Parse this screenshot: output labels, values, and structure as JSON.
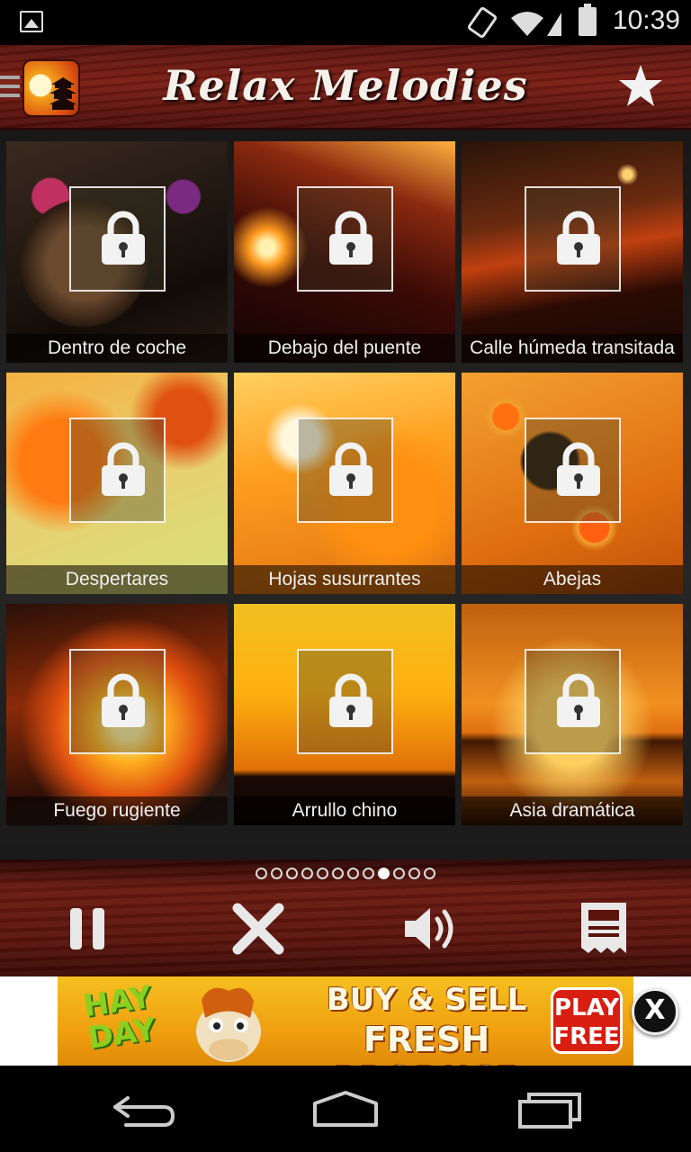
{
  "status_bar": {
    "time": "10:39",
    "icons": [
      "gallery-icon",
      "screen-rotation-icon",
      "wifi-icon",
      "signal-icon",
      "battery-icon"
    ]
  },
  "header": {
    "title": "Relax Melodies",
    "logo_icon": "pagoda-sunset-logo",
    "menu_icon": "hamburger-icon",
    "favorite_icon": "star-icon"
  },
  "grid": {
    "tiles": [
      {
        "label": "Dentro de coche",
        "locked": true,
        "scene": "car-interior"
      },
      {
        "label": "Debajo del puente",
        "locked": true,
        "scene": "bridge-night"
      },
      {
        "label": "Calle húmeda transitada",
        "locked": true,
        "scene": "wet-street"
      },
      {
        "label": "Despertares",
        "locked": true,
        "scene": "autumn-leaves"
      },
      {
        "label": "Hojas susurrantes",
        "locked": true,
        "scene": "whispering-leaves"
      },
      {
        "label": "Abejas",
        "locked": true,
        "scene": "bees-honeycomb"
      },
      {
        "label": "Fuego rugiente",
        "locked": true,
        "scene": "roaring-fire"
      },
      {
        "label": "Arrullo chino",
        "locked": true,
        "scene": "pagoda-sunset"
      },
      {
        "label": "Asia dramática",
        "locked": true,
        "scene": "acacia-sunset"
      }
    ]
  },
  "pager": {
    "total_pages": 12,
    "current_page": 9
  },
  "controls": {
    "pause_icon": "pause-icon",
    "clear_icon": "close-icon",
    "volume_icon": "volume-icon",
    "timer_icon": "timer-receipt-icon"
  },
  "ad": {
    "brand": "HAY DAY",
    "tagline_line1": "BUY & SELL",
    "tagline_line2": "FRESH PRODUCE",
    "cta_line1": "PLAY",
    "cta_line2": "FREE",
    "close_label": "X"
  },
  "nav_bar": {
    "icons": [
      "back-icon",
      "home-icon",
      "recent-apps-icon"
    ]
  },
  "colors": {
    "header_wood": "#6a1a10",
    "controls_wood": "#5a140c",
    "grid_bg": "#222222",
    "ad_bg": "#f0a010",
    "ad_cta": "#d81e10"
  }
}
